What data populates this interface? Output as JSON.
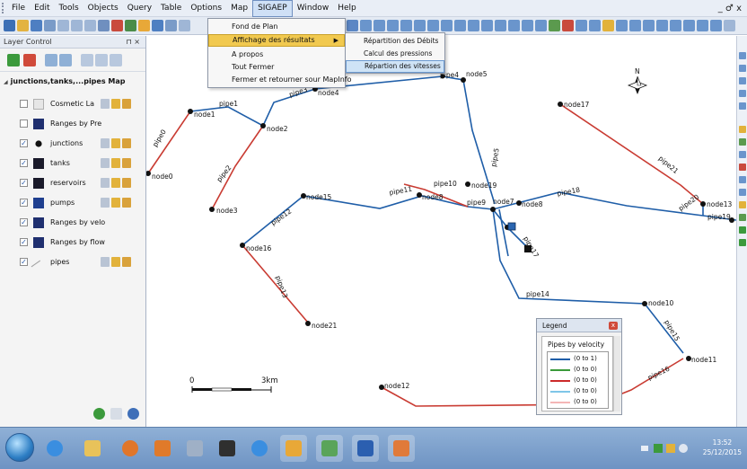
{
  "menubar": {
    "items": [
      "File",
      "Edit",
      "Tools",
      "Objects",
      "Query",
      "Table",
      "Options",
      "Map",
      "SIGAEP",
      "Window",
      "Help"
    ],
    "active": "SIGAEP",
    "window_controls": "_ ♂ x"
  },
  "dropdown": {
    "items": [
      "Fond de Plan",
      "Affichage des résultats",
      "A propos",
      "Tout Fermer",
      "Fermer et retourner sour MapInfo"
    ],
    "highlighted": "Affichage des résultats"
  },
  "submenu": {
    "items": [
      "Répartition des Débits",
      "Calcul des pressions",
      "Répartion des vitesses"
    ],
    "highlighted": "Répartion des vitesses"
  },
  "layer_control": {
    "title": "Layer Control",
    "close": "⊓ ×",
    "root": "junctions,tanks,...pipes Map",
    "layers": [
      {
        "label": "Cosmetic La",
        "checked": false,
        "symbol": "cosmetic"
      },
      {
        "label": "Ranges by Pre",
        "checked": false,
        "symbol": "theme"
      },
      {
        "label": "junctions",
        "checked": true,
        "symbol": "dot"
      },
      {
        "label": "tanks",
        "checked": true,
        "symbol": "square"
      },
      {
        "label": "reservoirs",
        "checked": true,
        "symbol": "square"
      },
      {
        "label": "pumps",
        "checked": true,
        "symbol": "pump"
      },
      {
        "label": "Ranges by velo",
        "checked": true,
        "symbol": "theme"
      },
      {
        "label": "Ranges by flow",
        "checked": true,
        "symbol": "theme"
      },
      {
        "label": "pipes",
        "checked": true,
        "symbol": "line"
      }
    ]
  },
  "map": {
    "nodes": [
      "node0",
      "node1",
      "node2",
      "node3",
      "node4",
      "node5",
      "node7",
      "node8",
      "node8",
      "node10",
      "node11",
      "node12",
      "node13",
      "node15",
      "node16",
      "node17",
      "node19",
      "node21"
    ],
    "pipes": [
      "pipe0",
      "pipe1",
      "pipe2",
      "pipe3",
      "pipe4",
      "pipe5",
      "pipe9",
      "pipe10",
      "pipe11",
      "pipe12",
      "pipe13",
      "pipe14",
      "pipe15",
      "pipe16",
      "pipe17",
      "pipe18",
      "pipe19",
      "pipe21",
      "pipe20"
    ],
    "scale_start": "0",
    "scale_end": "3km",
    "north": "N"
  },
  "legend": {
    "title": "Legend",
    "close": "x",
    "subtitle": "Pipes by velocity",
    "rows": [
      {
        "label": "(0 to 1)",
        "color": "#1f5ea8"
      },
      {
        "label": "(0 to 0)",
        "color": "#3a9a3a"
      },
      {
        "label": "(0 to 0)",
        "color": "#cc2a2a"
      },
      {
        "label": "(0 to 0)",
        "color": "#7fc6e8"
      },
      {
        "label": "(0 to 0)",
        "color": "#f4b6b6"
      }
    ]
  },
  "taskbar": {
    "time": "13:52",
    "date": "25/12/2015"
  },
  "colors": {
    "pipe_blue": "#1f5ea8",
    "pipe_red": "#c93b32",
    "accent": "#f1c94f"
  }
}
